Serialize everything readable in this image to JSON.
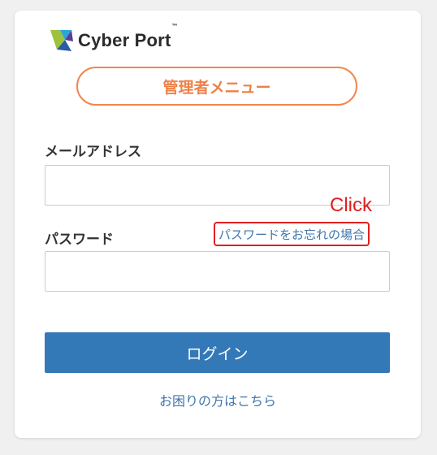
{
  "brand": {
    "name": "Cyber Port",
    "tm": "™"
  },
  "header": {
    "menu_title": "管理者メニュー"
  },
  "form": {
    "email_label": "メールアドレス",
    "email_value": "",
    "email_placeholder": "",
    "password_label": "パスワード",
    "password_value": "",
    "password_placeholder": "",
    "forgot_link": "パスワードをお忘れの場合",
    "login_button": "ログイン",
    "help_link": "お困りの方はこちら"
  },
  "annotation": {
    "click_text": "Click",
    "color": "#e02020"
  },
  "colors": {
    "accent_orange": "#f0864f",
    "button_blue": "#3479b7",
    "link_blue": "#3f76ad"
  }
}
